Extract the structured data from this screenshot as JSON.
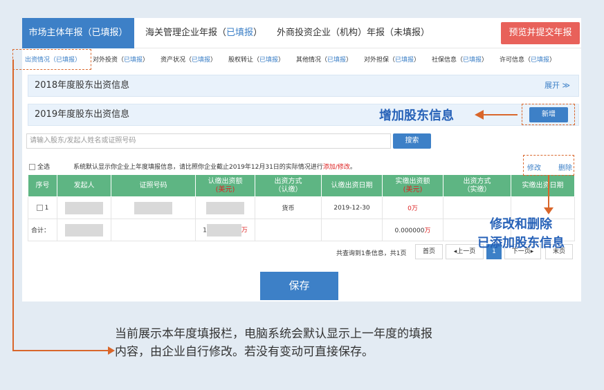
{
  "tabs": [
    {
      "label": "市场主体年报（已填报）"
    },
    {
      "label": "海关管理企业年报（",
      "status": "已填报",
      "close": "）"
    },
    {
      "label": "外商投资企业（机构）年报（未填报）"
    }
  ],
  "submit_label": "预览并提交年报",
  "subtabs": [
    {
      "label": "出资情况（",
      "status": "已填报",
      "close": "）"
    },
    {
      "label": "对外投资（",
      "status": "已填报",
      "close": "）"
    },
    {
      "label": "资产状况（",
      "status": "已填报",
      "close": "）"
    },
    {
      "label": "股权转让（",
      "status": "已填报",
      "close": "）"
    },
    {
      "label": "其他情况（",
      "status": "已填报",
      "close": "）"
    },
    {
      "label": "对外担保（",
      "status": "已填报",
      "close": "）"
    },
    {
      "label": "社保信息（",
      "status": "已填报",
      "close": "）"
    },
    {
      "label": "许可信息（",
      "status": "已填报",
      "close": "）"
    }
  ],
  "section_2018": {
    "title": "2018年度股东出资信息",
    "expand": "展开"
  },
  "section_2019": {
    "title": "2019年度股东出资信息"
  },
  "add_button": "新增",
  "search": {
    "placeholder": "请输入股东/发起人姓名或证照号码",
    "button": "搜索"
  },
  "select_all": "全选",
  "notice": {
    "text": "系统默认显示你企业上年度填报信息，请比照你企业截止2019年12月31日的实际情况进行",
    "link": "添加/修改",
    "end": "。"
  },
  "actions": {
    "edit": "修改",
    "delete": "删除"
  },
  "table": {
    "headers": [
      {
        "main": "序号"
      },
      {
        "main": "发起人"
      },
      {
        "main": "证照号码"
      },
      {
        "main": "认缴出资额",
        "unit": "(美元)"
      },
      {
        "main": "出资方式",
        "sub": "（认缴）"
      },
      {
        "main": "认缴出资日期"
      },
      {
        "main": "实缴出资额",
        "unit": "(美元)"
      },
      {
        "main": "出资方式",
        "sub": "（实缴）"
      },
      {
        "main": "实缴出资日期"
      }
    ],
    "row1": {
      "index": "1",
      "method": "货币",
      "date": "2019-12-30",
      "paid": "0万"
    },
    "total": {
      "label": "合计：",
      "subscribed_prefix": "1",
      "subscribed_suffix": "万",
      "paid": "0.000000",
      "paid_unit": "万"
    }
  },
  "pager": {
    "info": "共查询到1条信息，共1页",
    "first": "首页",
    "prev": "◂上一页",
    "current": "1",
    "next": "下一页▸",
    "last": "末页"
  },
  "save_label": "保存",
  "annotations": {
    "add": "增加股东信息",
    "edit_line1": "修改和删除",
    "edit_line2": "已添加股东信息"
  },
  "caption": {
    "line1": "当前展示本年度填报栏，电脑系统会默认显示上一年度的填报",
    "line2": "内容，由企业自行修改。若没有变动可直接保存。"
  },
  "colors": {
    "primary": "#3d80c7",
    "header_green": "#5eb583",
    "submit_red": "#e8615a",
    "annotation_orange": "#d9662a",
    "annotation_blue": "#2762b8"
  }
}
